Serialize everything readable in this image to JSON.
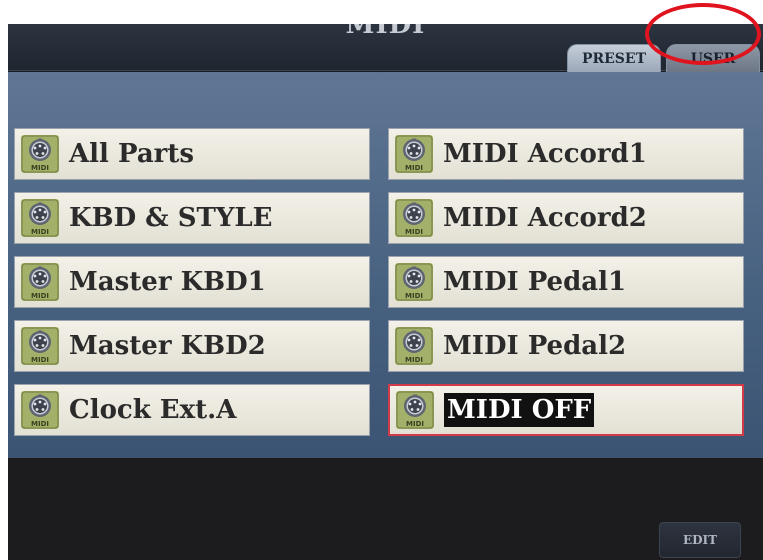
{
  "header": {
    "title": "MIDI"
  },
  "tabs": [
    {
      "label": "PRESET",
      "active": true
    },
    {
      "label": "USER",
      "active": false
    }
  ],
  "items": [
    {
      "label": "All Parts",
      "selected": false
    },
    {
      "label": "MIDI Accord1",
      "selected": false
    },
    {
      "label": "KBD & STYLE",
      "selected": false
    },
    {
      "label": "MIDI Accord2",
      "selected": false
    },
    {
      "label": "Master KBD1",
      "selected": false
    },
    {
      "label": "MIDI Pedal1",
      "selected": false
    },
    {
      "label": "Master KBD2",
      "selected": false
    },
    {
      "label": "MIDI Pedal2",
      "selected": false
    },
    {
      "label": "Clock Ext.A",
      "selected": false
    },
    {
      "label": "MIDI OFF",
      "selected": true
    }
  ],
  "icon": {
    "name": "midi-connector-icon",
    "caption": "MIDI"
  },
  "footer": {
    "edit_label": "EDIT"
  },
  "colors": {
    "panel": "#4f6788",
    "item_bg": "#efede3",
    "selection_border": "#d23a4a",
    "annotation": "#e0141e"
  }
}
